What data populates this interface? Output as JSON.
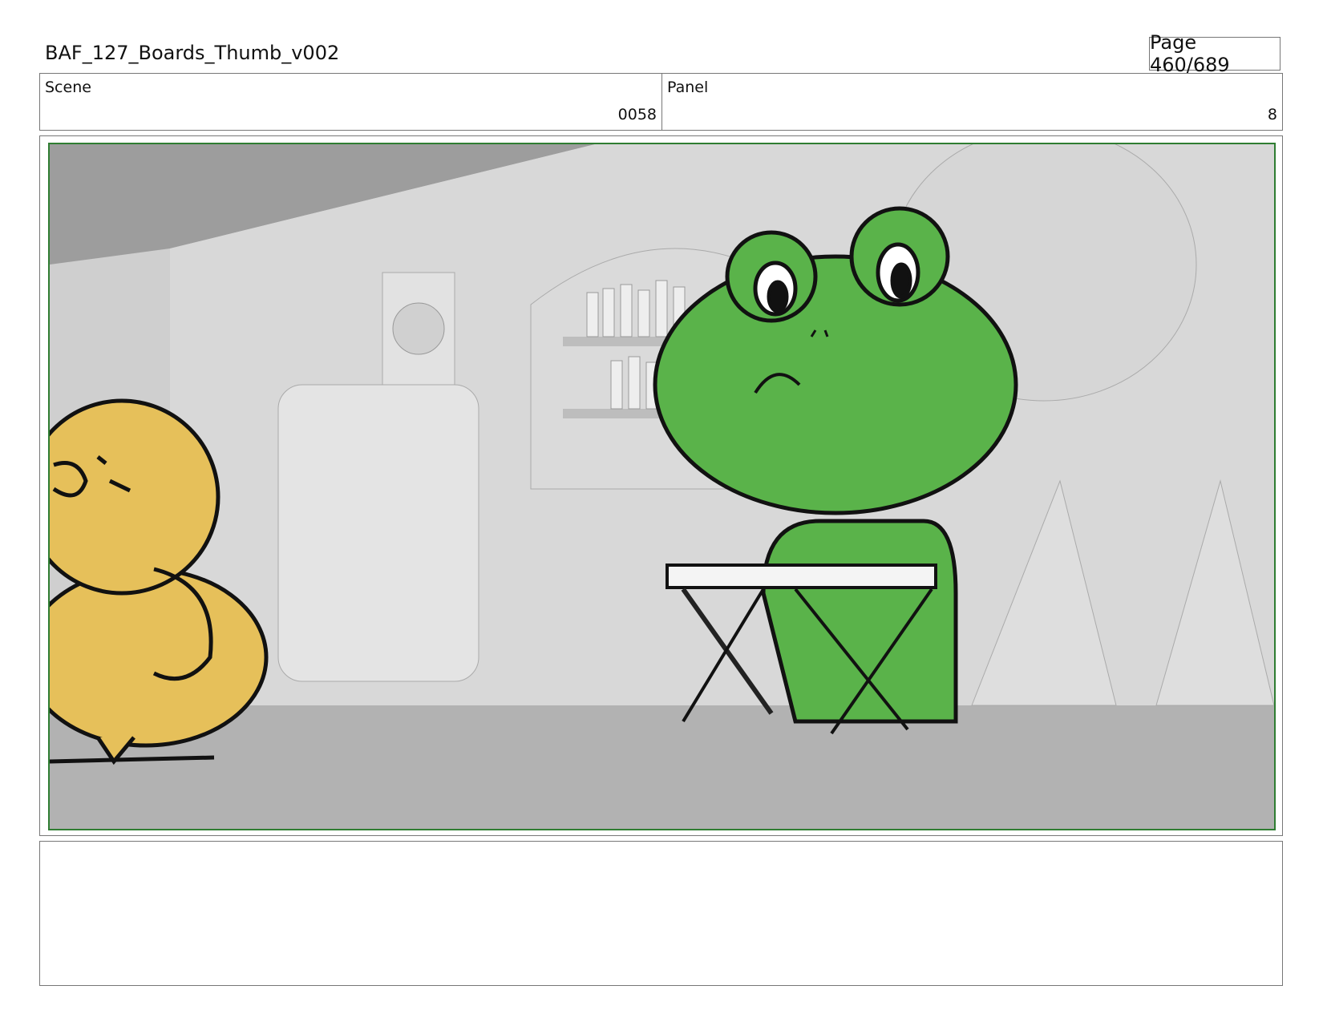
{
  "header": {
    "document_title": "BAF_127_Boards_Thumb_v002",
    "page_label": "Page 460/689"
  },
  "info": {
    "scene_label": "Scene",
    "scene_value": "0058",
    "panel_label": "Panel",
    "panel_value": "8"
  },
  "artwork": {
    "description_name": "storyboard-panel-frog-at-keyboard-with-duck",
    "frame_color": "#2f7d32",
    "frog_color": "#5ab34a",
    "duck_color": "#e6c05a"
  },
  "notes": {
    "text": ""
  }
}
